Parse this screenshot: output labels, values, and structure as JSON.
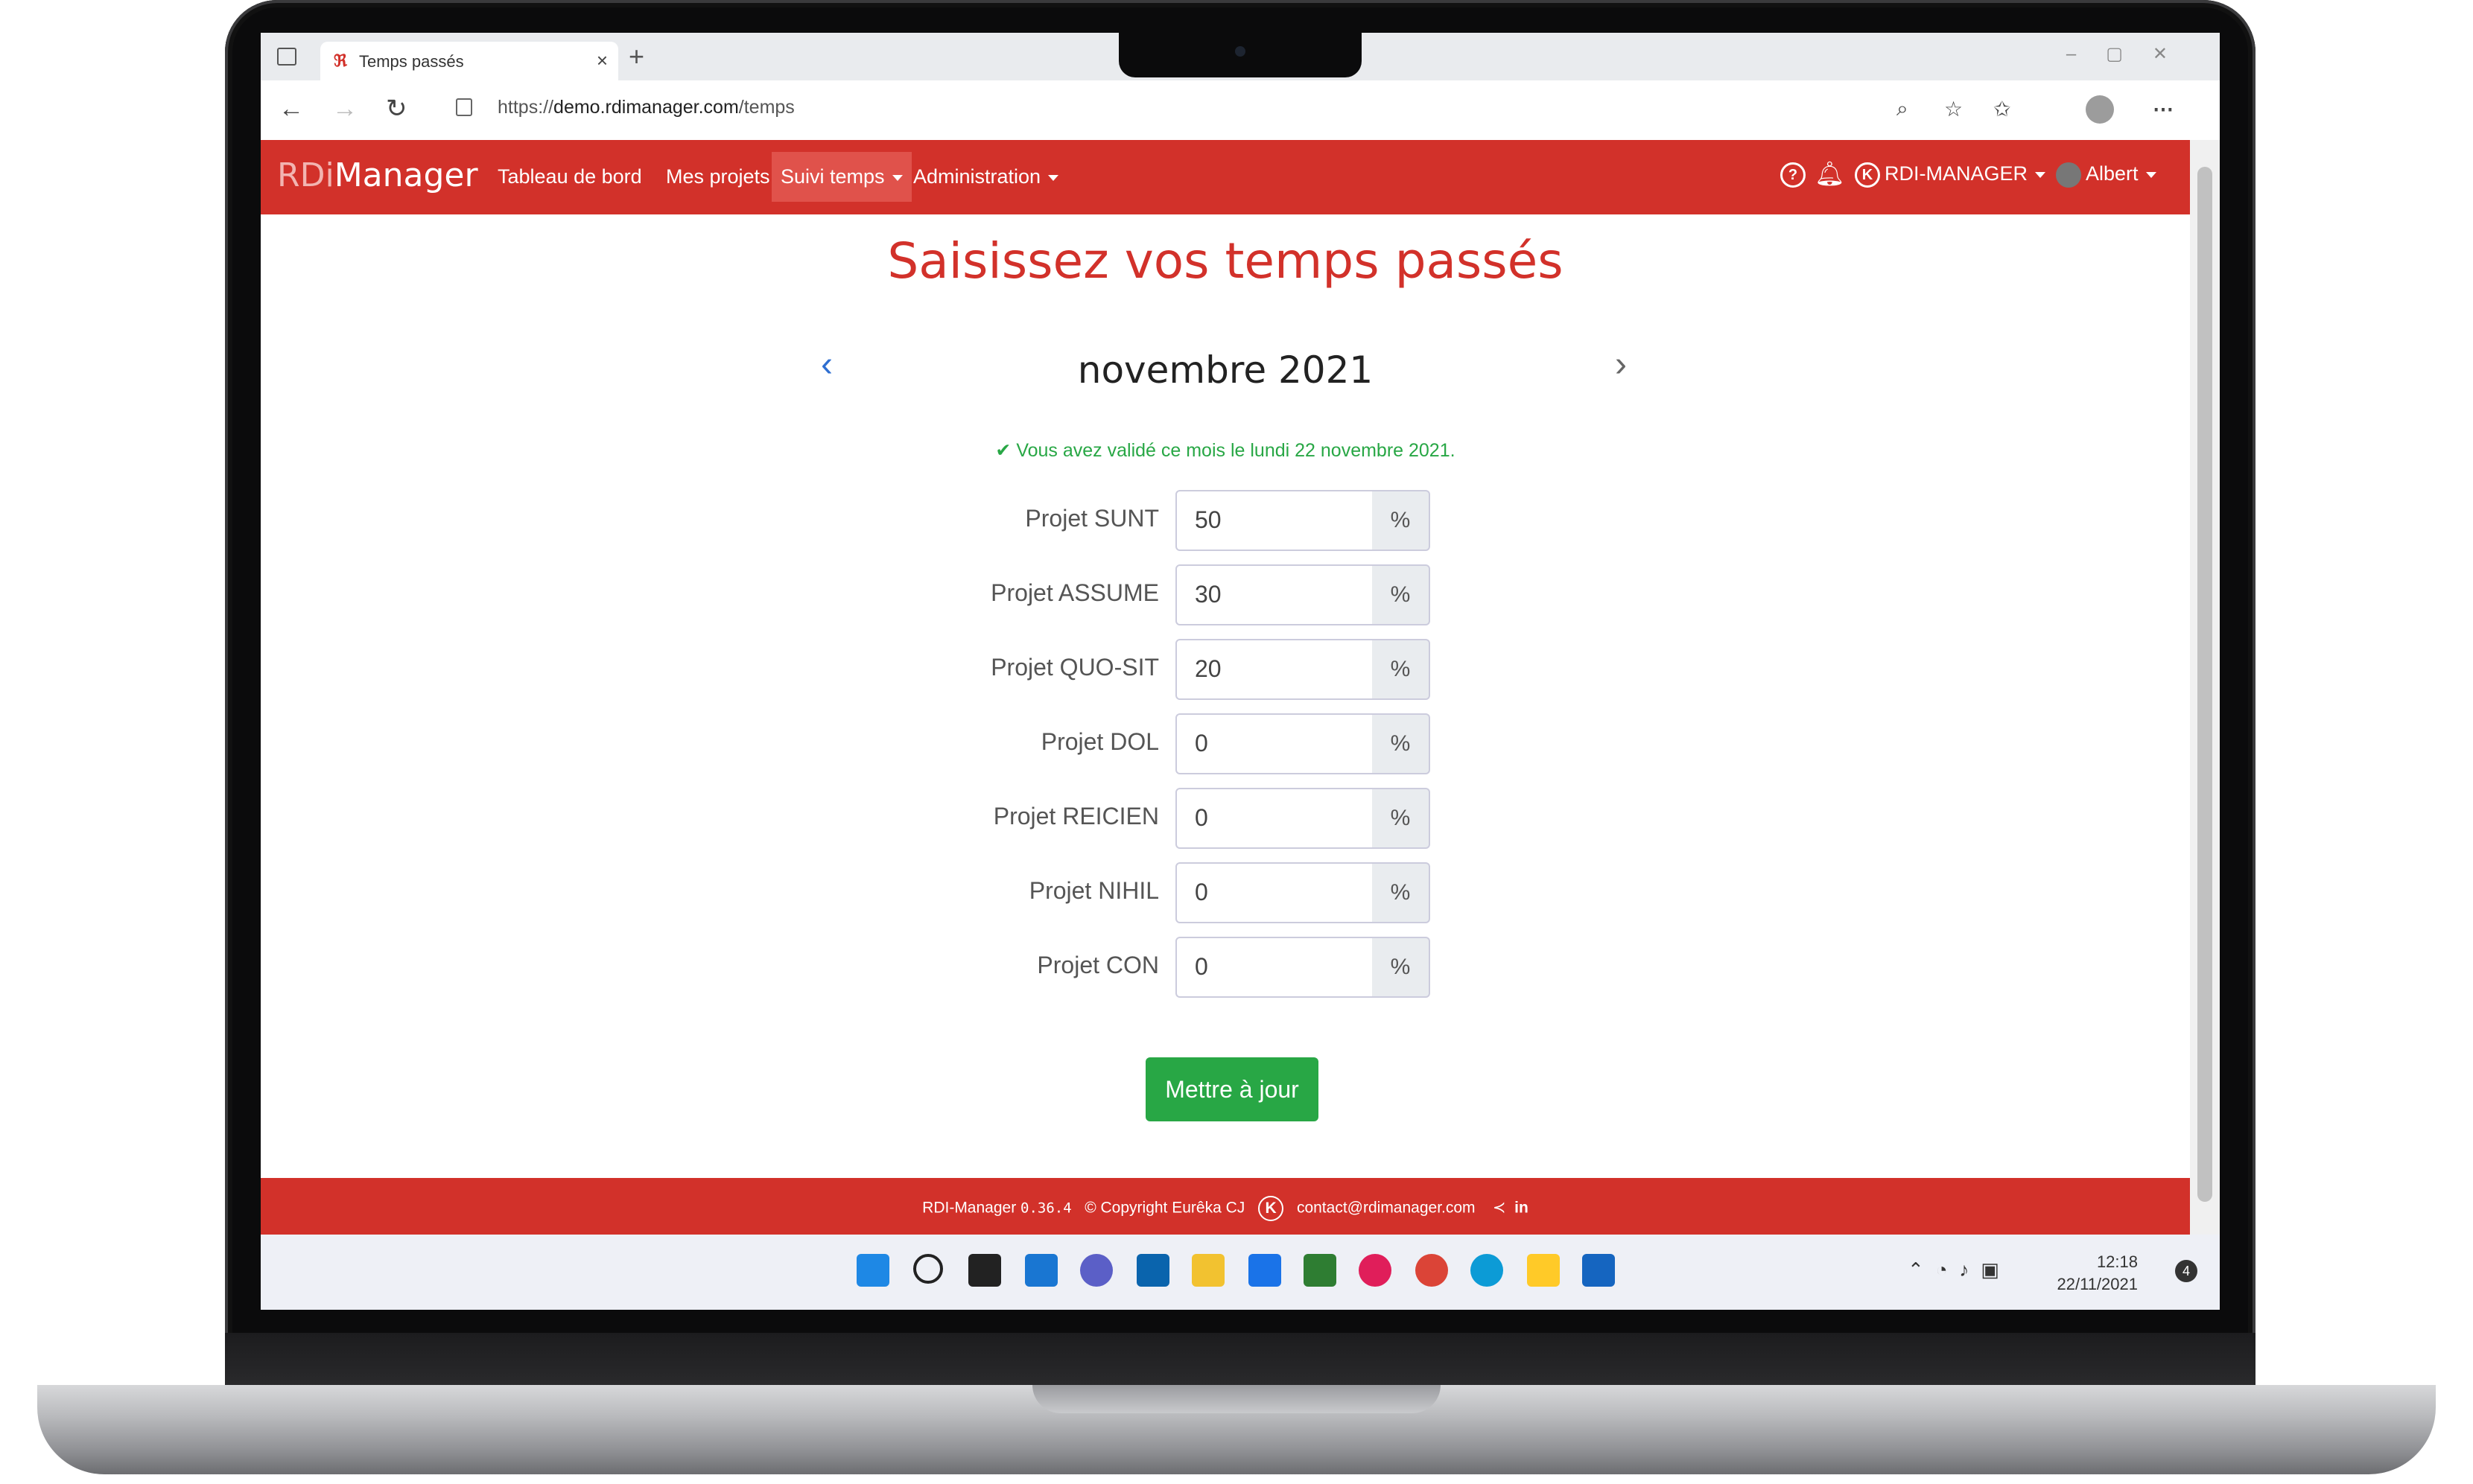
{
  "browser": {
    "tab_title": "Temps passés",
    "url_prefix": "https://",
    "url_host": "demo.rdimanager.com",
    "url_path": "/temps",
    "new_tab": "+",
    "tab_close": "×"
  },
  "navbar": {
    "brand_rd": "RDi",
    "brand_manager": "Manager",
    "items": [
      "Tableau de bord",
      "Mes projets",
      "Suivi temps",
      "Administration"
    ],
    "org": "RDI-MANAGER",
    "user": "Albert"
  },
  "page": {
    "title": "Saisissez vos temps passés",
    "month": "novembre 2021",
    "validation_message": "✔ Vous avez validé ce mois le lundi 22 novembre 2021.",
    "unit": "%",
    "submit_label": "Mettre à jour"
  },
  "projects": [
    {
      "label": "Projet SUNT",
      "value": "50"
    },
    {
      "label": "Projet ASSUME",
      "value": "30"
    },
    {
      "label": "Projet QUO-SIT",
      "value": "20"
    },
    {
      "label": "Projet DOL",
      "value": "0"
    },
    {
      "label": "Projet REICIEN",
      "value": "0"
    },
    {
      "label": "Projet NIHIL",
      "value": "0"
    },
    {
      "label": "Projet CON",
      "value": "0"
    }
  ],
  "footer": {
    "app": "RDI-Manager",
    "version": "0.36.4",
    "copyright": "© Copyright Eurêka CJ",
    "contact": "contact@rdimanager.com",
    "linkedin": "in"
  },
  "taskbar": {
    "time": "12:18",
    "date": "22/11/2021",
    "notifications": "4"
  },
  "colors": {
    "brand_red": "#d2312a",
    "success_green": "#28a745"
  }
}
